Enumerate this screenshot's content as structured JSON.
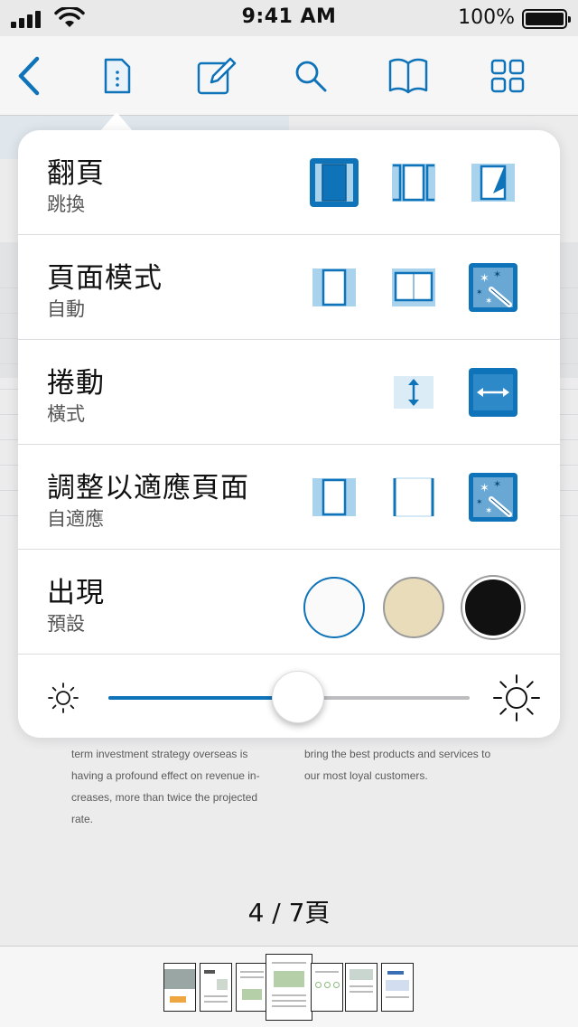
{
  "status_bar": {
    "time": "9:41 AM",
    "battery_percent": "100%"
  },
  "toolbar": {
    "icons": [
      "back-chevron-icon",
      "document-info-icon",
      "annotate-pencil-icon",
      "search-icon",
      "bookmarks-book-icon",
      "thumbnails-grid-icon"
    ],
    "accent_color": "#0e73b8"
  },
  "popover": {
    "rows": [
      {
        "title": "翻頁",
        "subtitle": "跳換",
        "options": [
          "single-page-jump-icon",
          "continuous-slide-icon",
          "page-curl-icon"
        ],
        "selected": 0
      },
      {
        "title": "頁面模式",
        "subtitle": "自動",
        "options": [
          "single-page-icon",
          "two-page-icon",
          "auto-magic-wand-icon"
        ],
        "selected": 2
      },
      {
        "title": "捲動",
        "subtitle": "橫式",
        "options": [
          "vertical-scroll-icon",
          "horizontal-scroll-icon"
        ],
        "selected": 1
      },
      {
        "title": "調整以適應頁面",
        "subtitle": "自適應",
        "options": [
          "fit-page-icon",
          "fit-width-icon",
          "auto-fit-magic-wand-icon"
        ],
        "selected": 2
      }
    ],
    "appearance": {
      "title": "出現",
      "subtitle": "預設",
      "themes": [
        {
          "name": "white",
          "color": "#fafafa"
        },
        {
          "name": "sepia",
          "color": "#e9dcba"
        },
        {
          "name": "night",
          "color": "#111111"
        }
      ],
      "selected": 0
    },
    "brightness": {
      "value": 0.5,
      "min_icon": "brightness-low-icon",
      "max_icon": "brightness-high-icon"
    }
  },
  "document": {
    "left_column": [
      "term investment strategy overseas is",
      "having a profound effect on revenue in-",
      "creases, more than twice the projected",
      "rate."
    ],
    "right_column": [
      "bring the best products and services to",
      "our most loyal customers."
    ],
    "page_indicator": "4 / 7頁"
  },
  "thumbnails": {
    "count": 7,
    "current": 3
  }
}
